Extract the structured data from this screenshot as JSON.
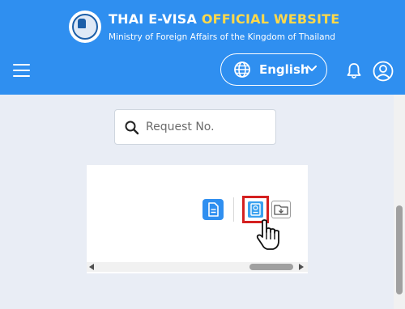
{
  "header": {
    "title_main": "THAI E-VISA",
    "title_accent": "OFFICIAL WEBSITE",
    "subtitle": "Ministry of Foreign Affairs of the Kingdom of Thailand",
    "logo": "seal-emblem-icon",
    "background_color": "#2f8ff0",
    "accent_color": "#ffd94a"
  },
  "nav": {
    "menu_icon": "hamburger-menu-icon",
    "language": {
      "label": "English",
      "icon": "globe-icon",
      "dropdown_icon": "chevron-down-icon"
    },
    "bell_icon": "bell-icon",
    "user_icon": "user-account-icon"
  },
  "search": {
    "placeholder": "Request No.",
    "value": "",
    "icon": "search-icon"
  },
  "table": {
    "actions": [
      {
        "name": "view-document",
        "icon": "document-icon"
      },
      {
        "name": "passport",
        "icon": "passport-icon",
        "highlighted": true
      },
      {
        "name": "download-folder",
        "icon": "folder-download-icon"
      }
    ]
  }
}
